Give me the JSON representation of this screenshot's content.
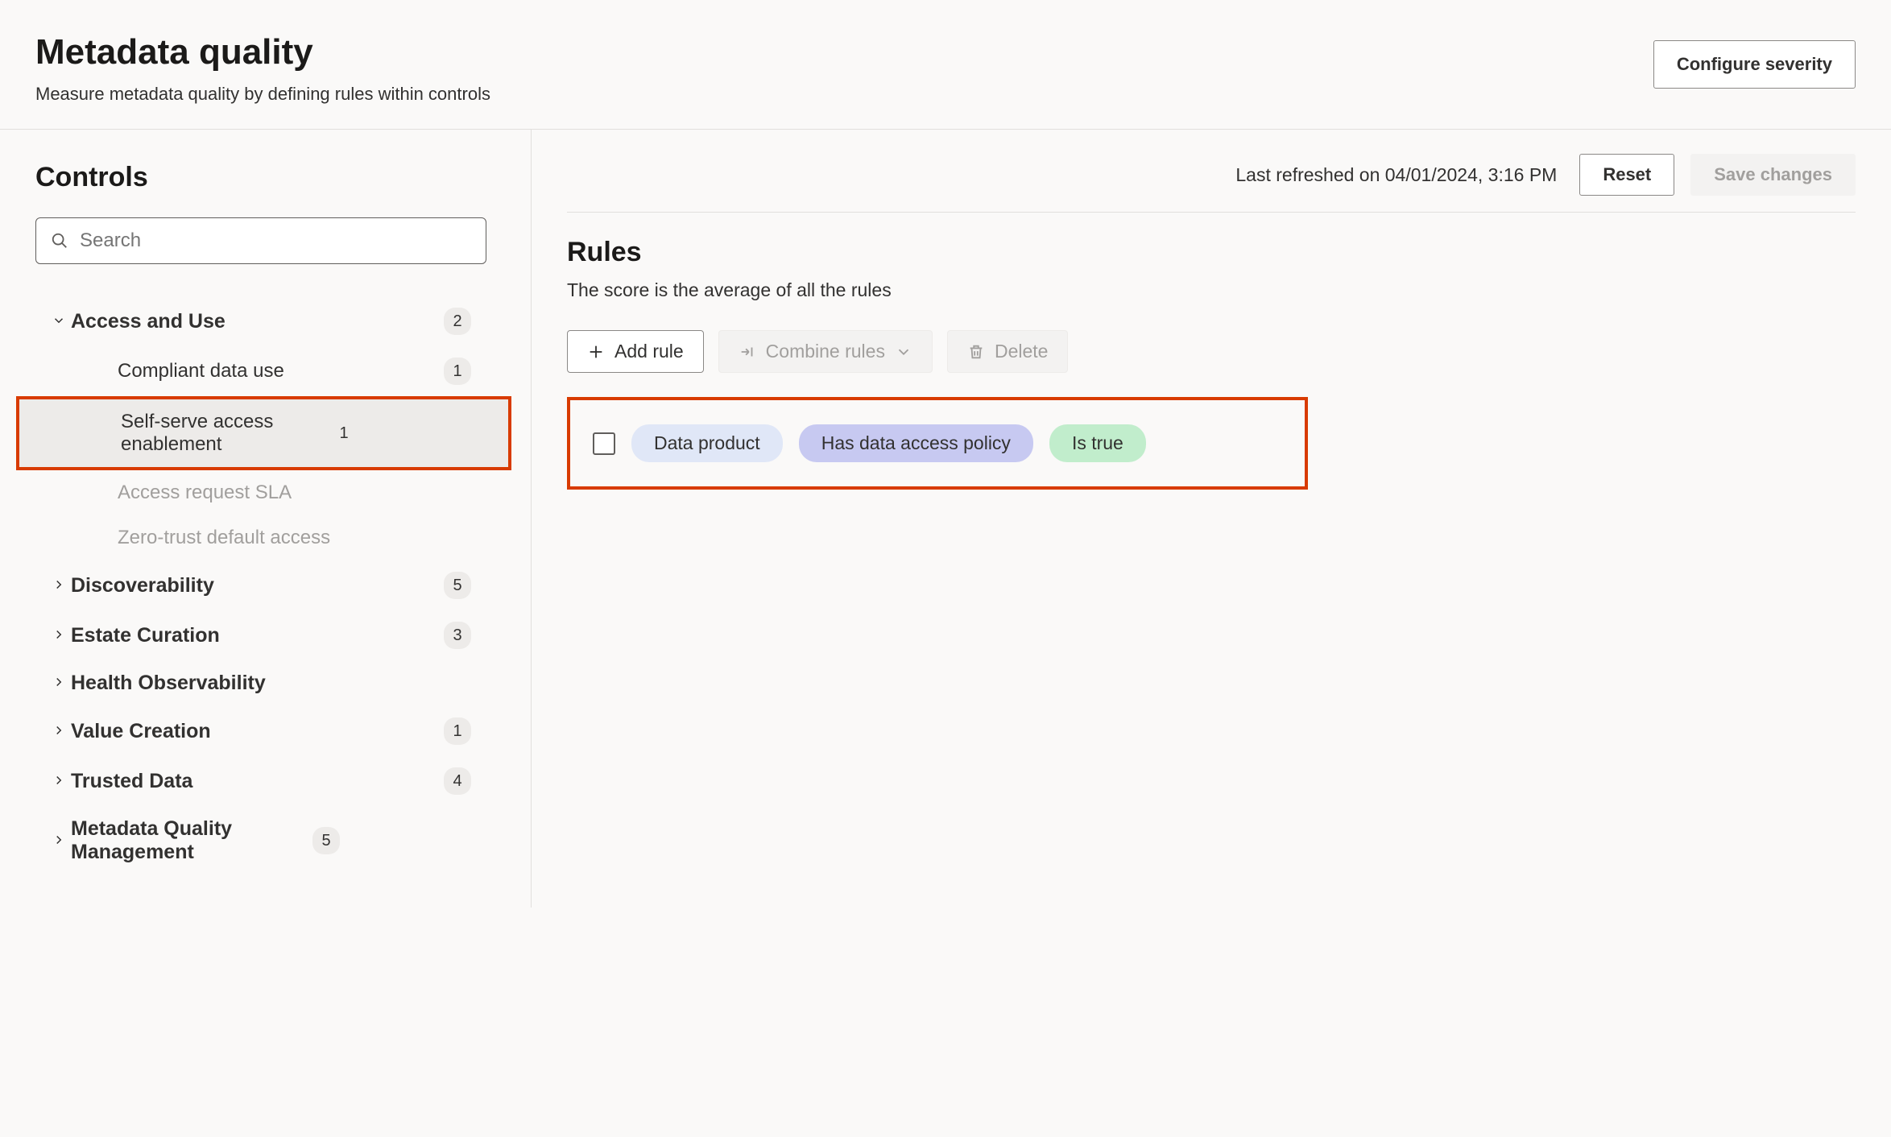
{
  "header": {
    "title": "Metadata quality",
    "subtitle": "Measure metadata quality by defining rules within controls",
    "configure_button": "Configure severity"
  },
  "sidebar": {
    "title": "Controls",
    "search_placeholder": "Search",
    "groups": [
      {
        "label": "Access and Use",
        "count": "2",
        "expanded": true,
        "children": [
          {
            "label": "Compliant data use",
            "count": "1",
            "selected": false,
            "disabled": false
          },
          {
            "label": "Self-serve access enablement",
            "count": "1",
            "selected": true,
            "disabled": false
          },
          {
            "label": "Access request SLA",
            "count": "",
            "selected": false,
            "disabled": true
          },
          {
            "label": "Zero-trust default access",
            "count": "",
            "selected": false,
            "disabled": true
          }
        ]
      },
      {
        "label": "Discoverability",
        "count": "5",
        "expanded": false
      },
      {
        "label": "Estate Curation",
        "count": "3",
        "expanded": false
      },
      {
        "label": "Health Observability",
        "count": "",
        "expanded": false
      },
      {
        "label": "Value Creation",
        "count": "1",
        "expanded": false
      },
      {
        "label": "Trusted Data",
        "count": "4",
        "expanded": false
      },
      {
        "label": "Metadata Quality Management",
        "count": "5",
        "expanded": false
      }
    ]
  },
  "main": {
    "last_refreshed": "Last refreshed on 04/01/2024, 3:16 PM",
    "reset_button": "Reset",
    "save_button": "Save changes",
    "rules_title": "Rules",
    "rules_subtitle": "The score is the average of all the rules",
    "add_rule": "Add rule",
    "combine_rules": "Combine rules",
    "delete": "Delete",
    "rule_pills": {
      "subject": "Data product",
      "predicate": "Has data access policy",
      "value": "Is true"
    }
  }
}
